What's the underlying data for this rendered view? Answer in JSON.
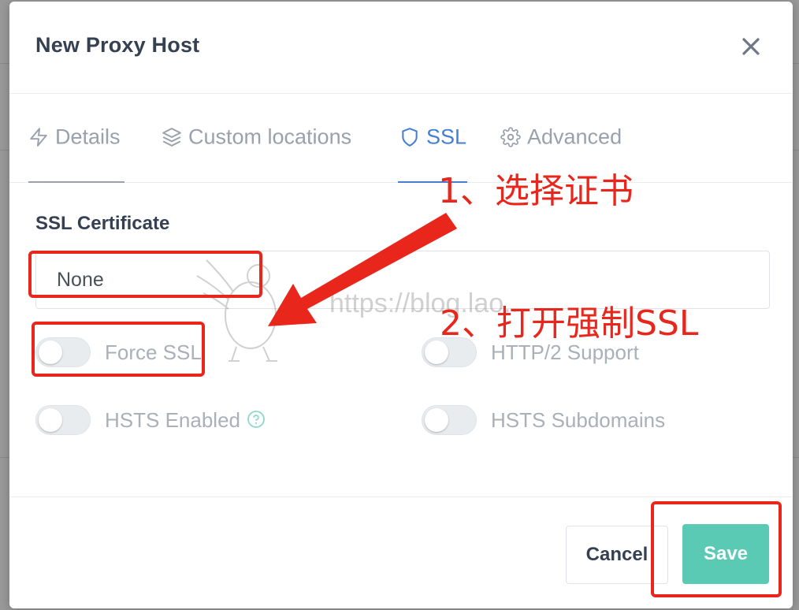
{
  "modal": {
    "title": "New Proxy Host"
  },
  "tabs": [
    {
      "label": "Details",
      "icon": "zap-icon",
      "active": false
    },
    {
      "label": "Custom locations",
      "icon": "layers-icon",
      "active": false
    },
    {
      "label": "SSL",
      "icon": "shield-icon",
      "active": true
    },
    {
      "label": "Advanced",
      "icon": "gear-icon",
      "active": false
    }
  ],
  "ssl": {
    "certificate_label": "SSL Certificate",
    "certificate_value": "None",
    "toggles": {
      "force_ssl": {
        "label": "Force SSL",
        "on": false
      },
      "http2": {
        "label": "HTTP/2 Support",
        "on": false
      },
      "hsts": {
        "label": "HSTS Enabled",
        "on": false
      },
      "hsts_sub": {
        "label": "HSTS Subdomains",
        "on": false
      }
    }
  },
  "footer": {
    "cancel_label": "Cancel",
    "save_label": "Save"
  },
  "annotations": {
    "step1": "1、选择证书",
    "step2": "2、打开强制SSL",
    "watermark": "https://blog.lao..."
  },
  "colors": {
    "accent": "#467fcf",
    "save": "#5bcab5",
    "annotation": "#e8261c"
  }
}
